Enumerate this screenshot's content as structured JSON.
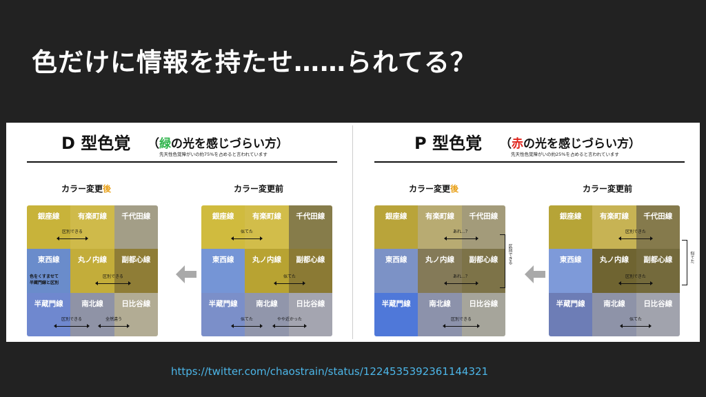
{
  "slide": {
    "title": "色だけに情報を持たせ……られてる？",
    "source_url": "https://twitter.com/chaostrain/status/1224535392361144321"
  },
  "colors": {
    "background": "#222222",
    "title": "#ffffff",
    "url": "#4cb6e8",
    "green_word": "#2db34a",
    "red_word": "#e0241c",
    "after_highlight": "#e8a018"
  },
  "panels": [
    {
      "heading": "D 型色覚",
      "sub_open": "（",
      "sub_color_word": "緑",
      "sub_rest": "の光を感じづらい方）",
      "note": "先天性色覚障がいの約75%を占めると言われています",
      "label_after_main": "カラー変更",
      "label_after_accent": "後",
      "label_before": "カラー変更前",
      "after_grid": {
        "cells": [
          {
            "name": "銀座線",
            "color": "#c8b33a"
          },
          {
            "name": "有楽町線",
            "color": "#cfba4a"
          },
          {
            "name": "千代田線",
            "color": "#a39e87"
          },
          {
            "name": "東西線",
            "color": "#6a8ccb"
          },
          {
            "name": "丸ノ内線",
            "color": "#c3ad3a"
          },
          {
            "name": "副都心線",
            "color": "#8f7d36"
          },
          {
            "name": "半蔵門線",
            "color": "#6f88cf"
          },
          {
            "name": "南北線",
            "color": "#8f93a6"
          },
          {
            "name": "日比谷線",
            "color": "#b2ac94"
          }
        ],
        "notes": [
          "区別できる",
          "色をくすませて",
          "半蔵門線と区別",
          "区別できる",
          "区別できる",
          "全然違う"
        ]
      },
      "before_grid": {
        "cells": [
          {
            "name": "銀座線",
            "color": "#d0bb3e"
          },
          {
            "name": "有楽町線",
            "color": "#d2bd4a"
          },
          {
            "name": "千代田線",
            "color": "#867c4a"
          },
          {
            "name": "東西線",
            "color": "#7595d6"
          },
          {
            "name": "丸ノ内線",
            "color": "#b8a332"
          },
          {
            "name": "副都心線",
            "color": "#8b7a34"
          },
          {
            "name": "半蔵門線",
            "color": "#7b8fc9"
          },
          {
            "name": "南北線",
            "color": "#9196ab"
          },
          {
            "name": "日比谷線",
            "color": "#a4a5b0"
          }
        ],
        "notes": [
          "似てた",
          "似てた",
          "似てた",
          "やや近かった"
        ]
      }
    },
    {
      "heading": "P 型色覚",
      "sub_open": "（",
      "sub_color_word": "赤",
      "sub_rest": "の光を感じづらい方）",
      "note": "先天性色覚障がいの約25%を占めると言われています",
      "label_after_main": "カラー変更",
      "label_after_accent": "後",
      "label_before": "カラー変更前",
      "after_grid": {
        "cells": [
          {
            "name": "銀座線",
            "color": "#b9a43a"
          },
          {
            "name": "有楽町線",
            "color": "#b8ab72"
          },
          {
            "name": "千代田線",
            "color": "#a39b7a"
          },
          {
            "name": "東西線",
            "color": "#7c92c6"
          },
          {
            "name": "丸ノ内線",
            "color": "#847a58"
          },
          {
            "name": "副都心線",
            "color": "#7d7348"
          },
          {
            "name": "半蔵門線",
            "color": "#4f78d9"
          },
          {
            "name": "南北線",
            "color": "#8c92ab"
          },
          {
            "name": "日比谷線",
            "color": "#a6a59b"
          }
        ],
        "notes": [
          "あれ…？",
          "あれ…？",
          "区別できる",
          "区別できる"
        ]
      },
      "before_grid": {
        "cells": [
          {
            "name": "銀座線",
            "color": "#b6a437"
          },
          {
            "name": "有楽町線",
            "color": "#c7b354"
          },
          {
            "name": "千代田線",
            "color": "#857a4c"
          },
          {
            "name": "東西線",
            "color": "#7e9ad9"
          },
          {
            "name": "丸ノ内線",
            "color": "#6f6431"
          },
          {
            "name": "副都心線",
            "color": "#746a3c"
          },
          {
            "name": "半蔵門線",
            "color": "#6d7db6"
          },
          {
            "name": "南北線",
            "color": "#8e93a8"
          },
          {
            "name": "日比谷線",
            "color": "#a1a3ad"
          }
        ],
        "notes": [
          "区別できた",
          "区別できた",
          "似てた",
          "似てた"
        ]
      }
    }
  ]
}
